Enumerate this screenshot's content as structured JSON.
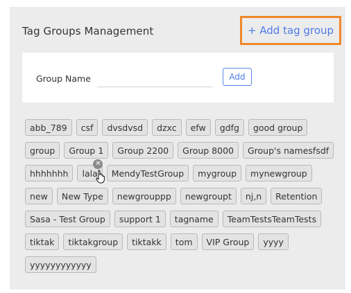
{
  "header": {
    "title": "Tag Groups Management",
    "add_link_label": "+ Add tag group"
  },
  "form": {
    "label": "Group Name",
    "input_value": "",
    "input_placeholder": "",
    "add_button_label": "Add"
  },
  "tags": [
    "abb_789",
    "csf",
    "dvsdvsd",
    "dzxc",
    "efw",
    "gdfg",
    "good group",
    "group",
    "Group 1",
    "Group 2200",
    "Group 8000",
    "Group's namesfsdf",
    "hhhhhhh",
    "lala",
    "MendyTestGroup",
    "mygroup",
    "mynewgroup",
    "new",
    "New Type",
    "newgrouppp",
    "newgroupt",
    "nj,n",
    "Retention",
    "Sasa - Test Group",
    "support 1",
    "tagname",
    "TeamTestsTeamTests",
    "tiktak",
    "tiktakgroup",
    "tiktakk",
    "tom",
    "VIP Group",
    "yyyy",
    "yyyyyyyyyyyy"
  ],
  "hovered_tag": {
    "label": "lala",
    "remove_icon": "close-icon",
    "cursor_icon": "hand-pointer-icon"
  },
  "colors": {
    "accent": "#4f7be8",
    "highlight_border": "#f0882a",
    "panel_bg": "#ececec",
    "tag_bg": "#e3e3e3"
  }
}
